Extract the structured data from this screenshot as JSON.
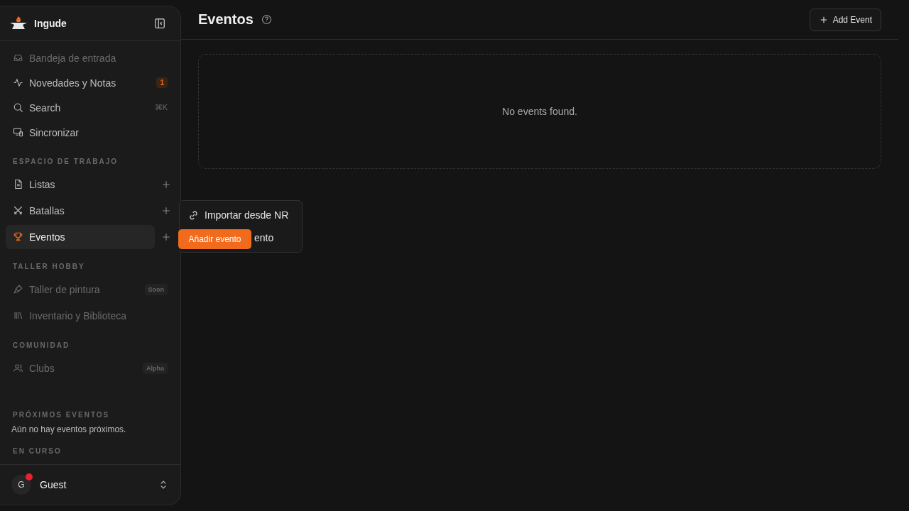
{
  "sidebar": {
    "brand": "Ingude",
    "nav": [
      {
        "label": "Bandeja de entrada",
        "disabled": true,
        "selected": false
      },
      {
        "label": "Novedades y Notas",
        "disabled": false,
        "selected": false,
        "badge": "1"
      },
      {
        "label": "Search",
        "disabled": false,
        "selected": false,
        "shortcut": "⌘K"
      },
      {
        "label": "Sincronizar",
        "disabled": false,
        "selected": false
      }
    ],
    "sections": [
      {
        "title": "ESPACIO DE TRABAJO",
        "items": [
          {
            "label": "Listas",
            "disabled": false,
            "selected": false,
            "add": true
          },
          {
            "label": "Batallas",
            "disabled": false,
            "selected": false,
            "add": true
          },
          {
            "label": "Eventos",
            "disabled": false,
            "selected": true,
            "add": true
          }
        ]
      },
      {
        "title": "TALLER HOBBY",
        "items": [
          {
            "label": "Taller de pintura",
            "disabled": true,
            "selected": false,
            "tag": "Soon"
          },
          {
            "label": "Inventario y Biblioteca",
            "disabled": true,
            "selected": false
          }
        ]
      },
      {
        "title": "COMUNIDAD",
        "items": [
          {
            "label": "Clubs",
            "disabled": true,
            "selected": false,
            "tag": "Alpha"
          }
        ]
      }
    ],
    "upcoming": {
      "title": "PRÓXIMOS EVENTOS",
      "text": "Aún no hay eventos próximos."
    },
    "ongoing": {
      "title": "EN CURSO"
    },
    "user": {
      "initial": "G",
      "name": "Guest",
      "notification": true
    }
  },
  "header": {
    "title": "Eventos",
    "add_button": "Add Event"
  },
  "empty": {
    "text": "No events found."
  },
  "menu": {
    "items": [
      {
        "label": "Importar desde NR"
      },
      {
        "label": "ento"
      }
    ]
  },
  "tooltip": {
    "text": "Añadir evento"
  }
}
